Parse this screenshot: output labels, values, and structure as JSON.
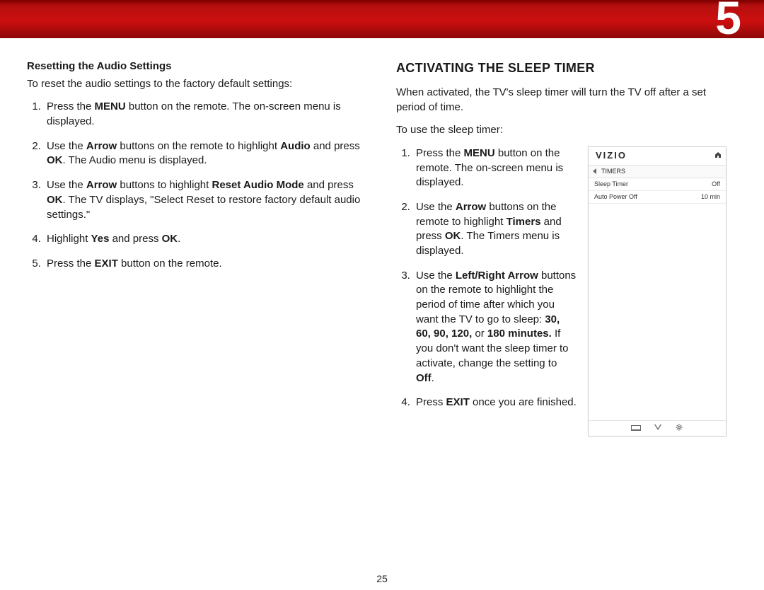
{
  "chapter": "5",
  "page_number": "25",
  "left": {
    "heading": "Resetting the Audio Settings",
    "intro": "To reset the audio settings to the factory default settings:",
    "steps": [
      {
        "pre": "Press the ",
        "b1": "MENU",
        "mid1": " button on the remote. The on-screen menu is displayed."
      },
      {
        "pre": "Use the ",
        "b1": "Arrow",
        "mid1": " buttons on the remote to highlight ",
        "b2": "Audio",
        "mid2": " and press ",
        "b3": "OK",
        "end": ". The Audio menu is displayed."
      },
      {
        "pre": "Use the ",
        "b1": "Arrow",
        "mid1": " buttons to highlight ",
        "b2": "Reset Audio Mode",
        "mid2": " and press ",
        "b3": "OK",
        "end": ". The TV displays, \"Select Reset to restore factory default audio settings.\""
      },
      {
        "pre": "Highlight ",
        "b1": "Yes",
        "mid1": " and press ",
        "b2": "OK",
        "end": "."
      },
      {
        "pre": "Press the ",
        "b1": "EXIT",
        "mid1": " button on the remote."
      }
    ]
  },
  "right": {
    "heading": "ACTIVATING THE SLEEP TIMER",
    "intro1": "When activated, the TV's sleep timer will turn the TV off after a set period of time.",
    "intro2": "To use the sleep timer:",
    "steps": [
      {
        "pre": "Press the ",
        "b1": "MENU",
        "mid1": " button on the remote. The on-screen menu is displayed."
      },
      {
        "pre": "Use the ",
        "b1": "Arrow",
        "mid1": " buttons on the remote to highlight ",
        "b2": "Timers",
        "mid2": " and press ",
        "b3": "OK",
        "end": ". The Timers menu is displayed."
      },
      {
        "pre": "Use the ",
        "b1": "Left/Right Arrow",
        "mid1": " buttons on the remote to highlight the period of time after which you want the TV to go to sleep: ",
        "b2": "30, 60, 90, 120,",
        "mid2": " or ",
        "b3": "180 minutes.",
        "end": " If you don't want the sleep timer to activate, change the setting to ",
        "b4": "Off",
        "end2": "."
      },
      {
        "pre": "Press ",
        "b1": "EXIT",
        "mid1": " once you are finished."
      }
    ]
  },
  "menu": {
    "brand": "VIZIO",
    "crumb": "TIMERS",
    "rows": [
      {
        "label": "Sleep Timer",
        "value": "Off"
      },
      {
        "label": "Auto Power Off",
        "value": "10 min"
      }
    ]
  }
}
